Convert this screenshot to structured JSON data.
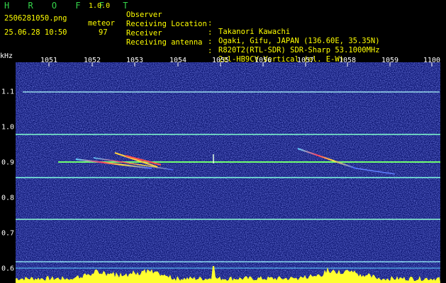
{
  "app": {
    "name": "H R O F F T",
    "version": "1.0.0"
  },
  "file": {
    "name": "2506281050.png",
    "timestamp": "25.06.28 10:50"
  },
  "detection": {
    "label": "meteor",
    "count": "97"
  },
  "info": [
    {
      "label": "Observer",
      "sep": ":",
      "value": "Takanori Kawachi"
    },
    {
      "label": "Receiving Location",
      "sep": ":",
      "value": "Ogaki, Gifu, JAPAN (136.60E, 35.35N)"
    },
    {
      "label": "Receiver",
      "sep": ":",
      "value": "R820T2(RTL-SDR) SDR-Sharp 53.1000MHz"
    },
    {
      "label": "Receiving antenna",
      "sep": ":",
      "value": "2el-HB9CV Vertical (el. E-W)"
    }
  ],
  "axes": {
    "unit": "kHz",
    "x_ticks": [
      "1051",
      "1052",
      "1053",
      "1054",
      "1055",
      "1056",
      "1057",
      "1058",
      "1059",
      "1100"
    ],
    "y_ticks": [
      "1.1",
      "1.0",
      "0.9",
      "0.8",
      "0.7",
      "0.6"
    ]
  },
  "colors": {
    "header_text": "#ffff00",
    "logo": "#35d54a",
    "background": "#0a1370"
  }
}
